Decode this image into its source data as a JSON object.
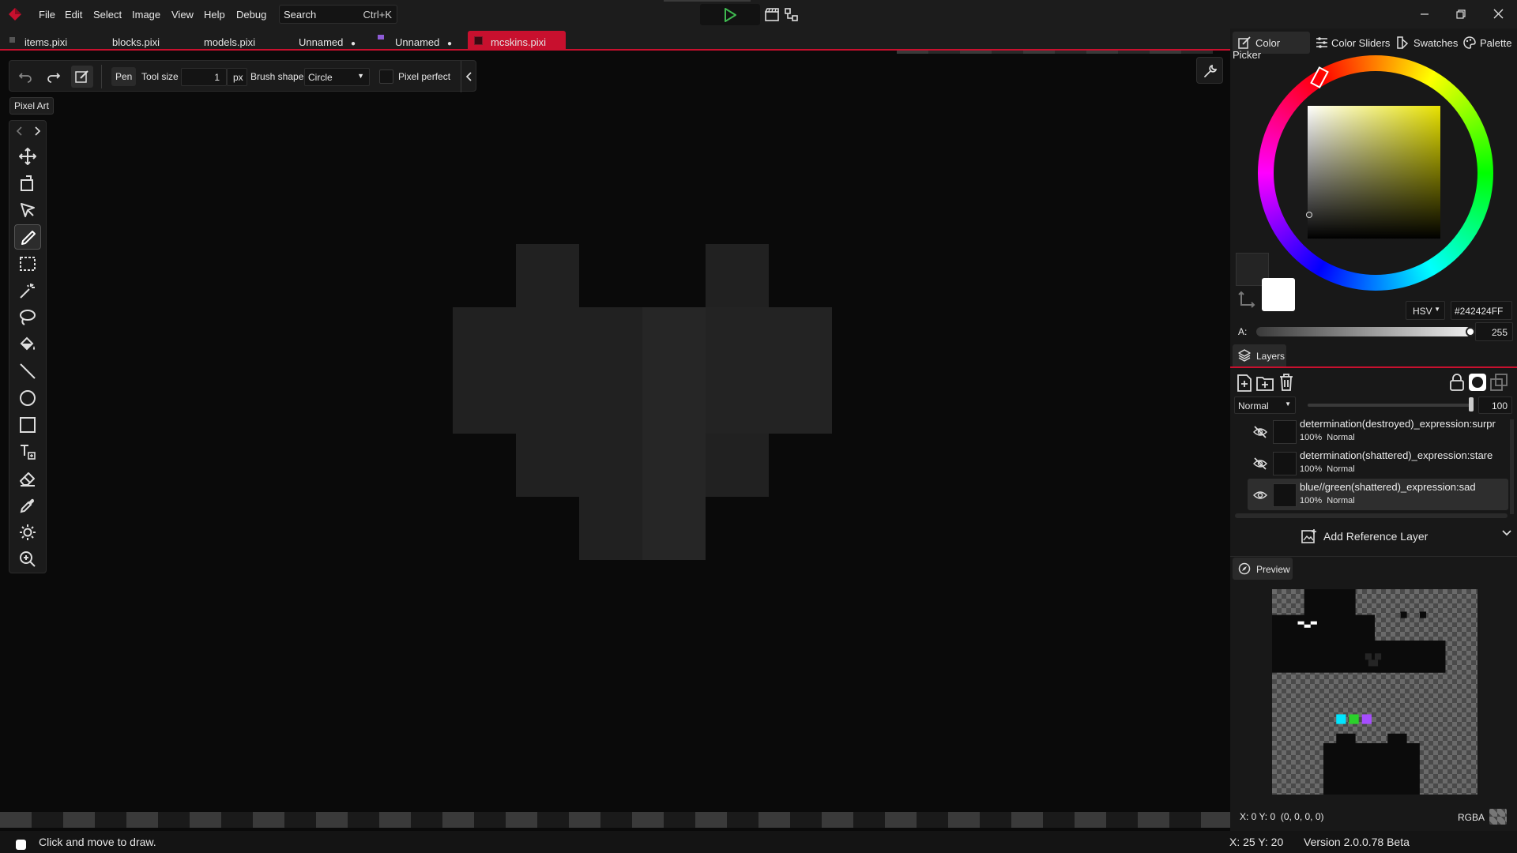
{
  "menubar": {
    "items": [
      "File",
      "Edit",
      "Select",
      "Image",
      "View",
      "Help",
      "Debug"
    ],
    "search_placeholder": "Search",
    "search_shortcut": "Ctrl+K"
  },
  "tabs": [
    {
      "label": "items.pixi",
      "modified": false
    },
    {
      "label": "blocks.pixi",
      "modified": false
    },
    {
      "label": "models.pixi",
      "modified": false
    },
    {
      "label": "Unnamed",
      "modified": true
    },
    {
      "label": "Unnamed",
      "modified": true
    },
    {
      "label": "mcskins.pixi",
      "modified": false,
      "active": true
    }
  ],
  "tool_options": {
    "tool_name": "Pen",
    "tool_size_label": "Tool size",
    "tool_size_value": "1",
    "tool_size_unit": "px",
    "brush_shape_label": "Brush shape",
    "brush_shape_value": "Circle",
    "pixel_perfect_label": "Pixel perfect",
    "pixel_perfect_checked": false
  },
  "toolset_tooltip": "Pixel Art",
  "tools": [
    "move-tool",
    "rotate-tool",
    "select-pointer-tool",
    "pen-tool",
    "rectangle-select-tool",
    "magic-wand-tool",
    "lasso-tool",
    "fill-tool",
    "line-tool",
    "ellipse-tool",
    "rectangle-tool",
    "text-tool",
    "eraser-tool",
    "color-picker-tool",
    "brightness-tool",
    "zoom-tool"
  ],
  "selected_tool": "pen-tool",
  "color_panel": {
    "tabs": [
      "Color Picker",
      "Color Sliders",
      "Swatches",
      "Palette"
    ],
    "active_tab": "Color Picker",
    "mode": "HSV",
    "hex": "#242424FF",
    "alpha_label": "A:",
    "alpha_value": "255",
    "primary_color": "#242424",
    "secondary_color": "#ffffff",
    "hue_color": "#e8e200"
  },
  "layers": {
    "title": "Layers",
    "blend_mode": "Normal",
    "opacity": "100",
    "items": [
      {
        "name": "determination(destroyed)_expression:surpr",
        "opacity": "100%",
        "blend": "Normal",
        "visible": false
      },
      {
        "name": "determination(shattered)_expression:stare",
        "opacity": "100%",
        "blend": "Normal",
        "visible": false
      },
      {
        "name": "blue//green(shattered)_expression:sad",
        "opacity": "100%",
        "blend": "Normal",
        "visible": true,
        "selected": true
      }
    ],
    "add_reference_label": "Add Reference Layer"
  },
  "preview": {
    "title": "Preview",
    "coords": "X: 0 Y: 0",
    "pixel_value": "(0, 0, 0, 0)",
    "channel_mode": "RGBA"
  },
  "statusbar": {
    "hint": "Click and move to draw.",
    "cursor": "X: 25 Y: 20",
    "version": "Version 2.0.0.78 Beta"
  },
  "colors": {
    "accent": "#c8102e",
    "play": "#3fb950",
    "heart_a": "#212121",
    "heart_b": "#262626"
  }
}
